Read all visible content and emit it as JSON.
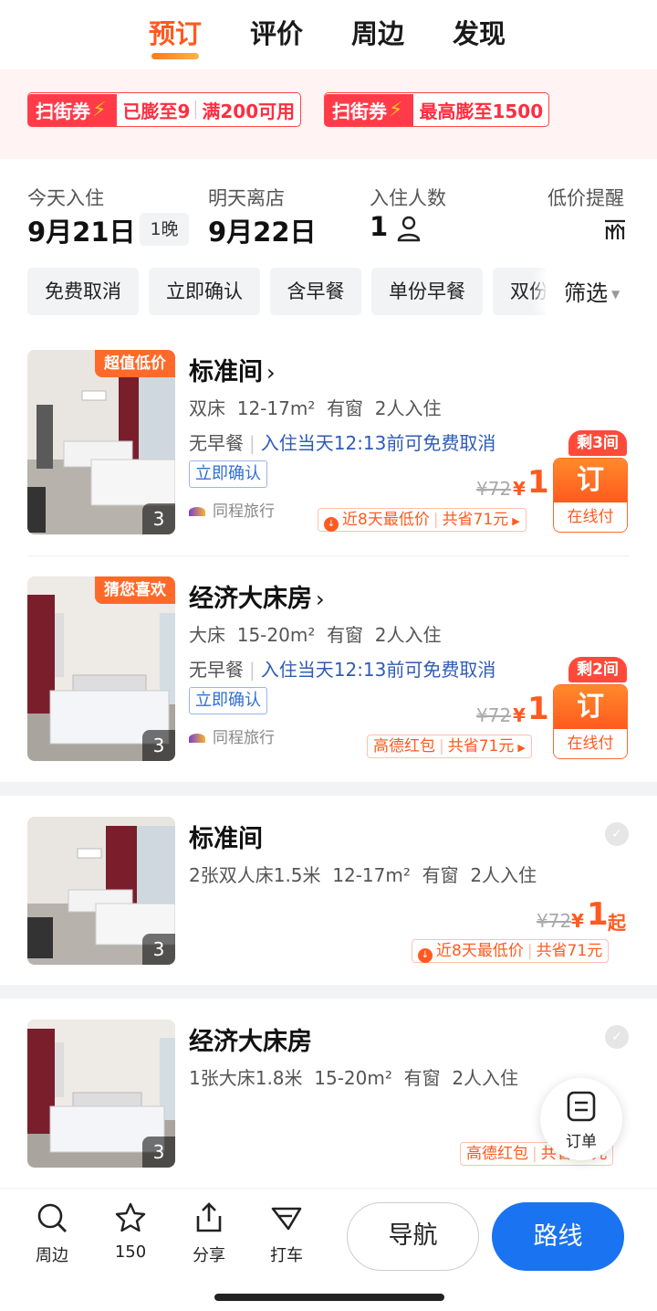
{
  "tabs": [
    {
      "label": "预订",
      "active": true
    },
    {
      "label": "评价",
      "active": false
    },
    {
      "label": "周边",
      "active": false
    },
    {
      "label": "发现",
      "active": false
    }
  ],
  "coupons": [
    {
      "tag": "扫街券",
      "text1": "已膨至9",
      "text2": "满200可用"
    },
    {
      "tag": "扫街券",
      "text1": "最高膨至1500"
    }
  ],
  "stay": {
    "checkin_label": "今天入住",
    "checkin_date": "9月21日",
    "nights": "1晚",
    "checkout_label": "明天离店",
    "checkout_date": "9月22日",
    "guests_label": "入住人数",
    "guests_value": "1",
    "alert_label": "低价提醒"
  },
  "filters": {
    "chips": [
      "免费取消",
      "立即确认",
      "含早餐",
      "单份早餐",
      "双份"
    ],
    "filter_label": "筛选"
  },
  "rooms": [
    {
      "badge": "超值低价",
      "photo_count": "3",
      "name": "标准间",
      "bed": "双床",
      "area": "12-17m²",
      "window": "有窗",
      "occupancy": "2人入住",
      "meal": "无早餐",
      "cancel": "入住当天12:13前可免费取消",
      "confirm": "立即确认",
      "vendor": "同程旅行",
      "old_price": "¥72",
      "yen": "¥",
      "price": "1",
      "rooms_left": "剩3间",
      "book": "订",
      "pay": "在线付",
      "promo1": "近8天最低价",
      "promo2": "共省71元"
    },
    {
      "badge": "猜您喜欢",
      "photo_count": "3",
      "name": "经济大床房",
      "bed": "大床",
      "area": "15-20m²",
      "window": "有窗",
      "occupancy": "2人入住",
      "meal": "无早餐",
      "cancel": "入住当天12:13前可免费取消",
      "confirm": "立即确认",
      "vendor": "同程旅行",
      "old_price": "¥72",
      "yen": "¥",
      "price": "1",
      "rooms_left": "剩2间",
      "book": "订",
      "pay": "在线付",
      "promo1": "高德红包",
      "promo2": "共省71元"
    },
    {
      "photo_count": "3",
      "name": "标准间",
      "bed": "2张双人床1.5米",
      "area": "12-17m²",
      "window": "有窗",
      "occupancy": "2人入住",
      "old_price": "¥72",
      "yen": "¥",
      "price": "1",
      "qi": "起",
      "promo1": "近8天最低价",
      "promo2": "共省71元"
    },
    {
      "photo_count": "3",
      "name": "经济大床房",
      "bed": "1张大床1.8米",
      "area": "15-20m²",
      "window": "有窗",
      "occupancy": "2人入住",
      "promo1": "高德红包",
      "promo2": "共省71元"
    }
  ],
  "float_order": {
    "label": "订单"
  },
  "bottombar": {
    "nearby": "周边",
    "favorites": "150",
    "share": "分享",
    "taxi": "打车",
    "navigate": "导航",
    "route": "路线"
  },
  "colors": {
    "accent": "#ff5a1f",
    "primary_blue": "#1a73f0",
    "link_blue": "#2f5bb7",
    "coupon_red": "#ff3b4a"
  }
}
